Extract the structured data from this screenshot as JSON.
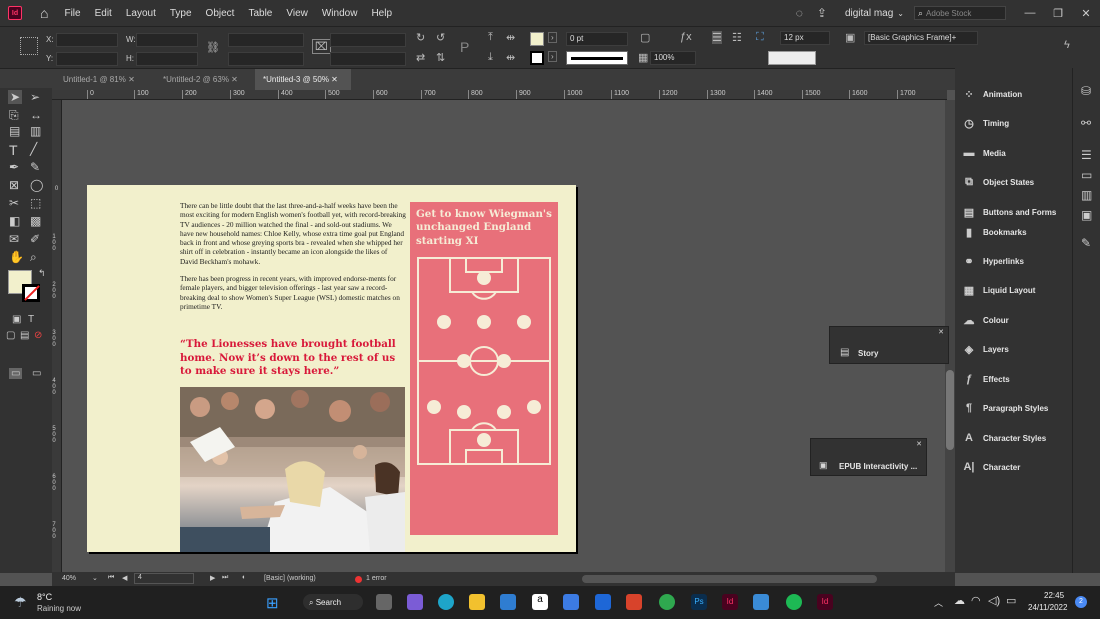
{
  "menubar": {
    "logo": "Id",
    "items": [
      "File",
      "Edit",
      "Layout",
      "Type",
      "Object",
      "Table",
      "View",
      "Window",
      "Help"
    ],
    "workspace": "digital mag",
    "search_placeholder": "Adobe Stock"
  },
  "control": {
    "x_label": "X:",
    "y_label": "Y:",
    "w_label": "W:",
    "h_label": "H:",
    "stroke_weight": "0 pt",
    "zoom_percent": "100%",
    "font_size": "12 px",
    "frame_style": "[Basic Graphics Frame]+"
  },
  "tabs": [
    {
      "label": "Untitled-1 @ 81%"
    },
    {
      "label": "*Untitled-2 @ 63%"
    },
    {
      "label": "*Untitled-3 @ 50%"
    }
  ],
  "ruler_h": [
    "0",
    "100",
    "200",
    "300",
    "400",
    "500",
    "600",
    "700",
    "800",
    "900",
    "1000",
    "1100",
    "1200",
    "1300",
    "1400",
    "1500",
    "1600",
    "1700"
  ],
  "ruler_v": [
    "0",
    "1 0 0",
    "2 0 0",
    "3 0 0",
    "4 0 0",
    "5 0 0",
    "6 0 0",
    "7 0 0"
  ],
  "article": {
    "para1": "There can be little doubt that the last three-and-a-half weeks have been the most exciting for modern English women's football yet, with record-breaking TV audiences - 20 million watched the final - and sold-out stadiums. We have new household names: Chloe Kelly, whose extra time goal put England back in front and whose greying sports bra - revealed when she whipped her shirt off in celebration - instantly became an icon alongside the likes of David Beckham's mohawk.",
    "para2": "There has been progress in recent years, with improved endorse-ments for female players, and bigger television offerings - last year saw a record-breaking deal to show Women's Super League (WSL) domestic matches on primetime TV.",
    "quote": "“The Lionesses have brought football home. Now it’s down to the rest of us to make sure it stays here.”",
    "sidebar_title": "Get to know Wiegman's unchanged England starting XI"
  },
  "status": {
    "zoom": "40%",
    "page": "4",
    "style": "[Basic] (working)",
    "errors": "1 error"
  },
  "panels": [
    {
      "icon": "animation-icon",
      "label": "Animation"
    },
    {
      "icon": "timing-icon",
      "label": "Timing"
    },
    {
      "icon": "media-icon",
      "label": "Media"
    },
    {
      "icon": "object-states-icon",
      "label": "Object States"
    },
    {
      "icon": "buttons-forms-icon",
      "label": "Buttons and Forms"
    },
    {
      "icon": "bookmarks-icon",
      "label": "Bookmarks"
    },
    {
      "icon": "hyperlinks-icon",
      "label": "Hyperlinks"
    },
    {
      "icon": "liquid-layout-icon",
      "label": "Liquid Layout"
    },
    {
      "icon": "colour-icon",
      "label": "Colour"
    },
    {
      "icon": "layers-icon",
      "label": "Layers"
    },
    {
      "icon": "effects-icon",
      "label": "Effects"
    },
    {
      "icon": "paragraph-styles-icon",
      "label": "Paragraph Styles"
    },
    {
      "icon": "character-styles-icon",
      "label": "Character Styles"
    },
    {
      "icon": "character-icon",
      "label": "Character"
    }
  ],
  "floating": {
    "story": "Story",
    "epub": "EPUB Interactivity ..."
  },
  "taskbar": {
    "temperature": "8°C",
    "weather": "Raining now",
    "search": "Search",
    "time": "22:45",
    "date": "24/11/2022",
    "badge": "2"
  },
  "colors": {
    "page_bg": "#f2f0cc",
    "quote": "#d8193a",
    "sidebar_pink": "#e8707a",
    "pitch_lines": "#f6ecd6"
  }
}
